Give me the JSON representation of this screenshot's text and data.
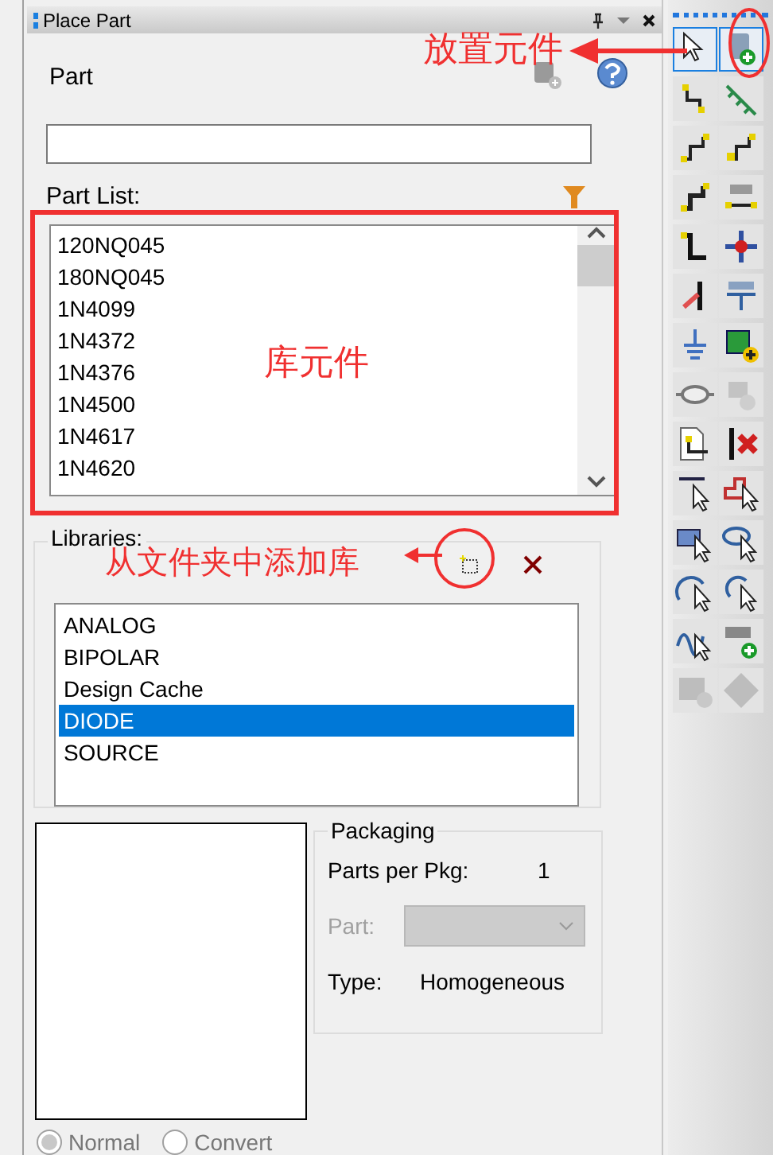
{
  "panel": {
    "title": "Place Part"
  },
  "part": {
    "label": "Part"
  },
  "part_list": {
    "label": "Part List:",
    "items": [
      "120NQ045",
      "180NQ045",
      "1N4099",
      "1N4372",
      "1N4376",
      "1N4500",
      "1N4617",
      "1N4620"
    ]
  },
  "libraries": {
    "label": "Libraries:",
    "items": [
      {
        "name": "ANALOG",
        "selected": false
      },
      {
        "name": "BIPOLAR",
        "selected": false
      },
      {
        "name": "Design Cache",
        "selected": false
      },
      {
        "name": "DIODE",
        "selected": true
      },
      {
        "name": "SOURCE",
        "selected": false
      }
    ]
  },
  "packaging": {
    "title": "Packaging",
    "parts_per_pkg_label": "Parts per Pkg:",
    "parts_per_pkg": "1",
    "part_label": "Part:",
    "part_disabled": true,
    "type_label": "Type:",
    "type": "Homogeneous"
  },
  "view": [
    {
      "label": "Normal",
      "selected": true
    },
    {
      "label": "Convert",
      "selected": false
    }
  ],
  "toolbar": [
    {
      "selected": true,
      "disabled": false
    },
    {
      "selected": true,
      "disabled": false
    },
    {
      "selected": false,
      "disabled": false
    },
    {
      "selected": false,
      "disabled": false
    },
    {
      "selected": false,
      "disabled": false
    },
    {
      "selected": false,
      "disabled": false
    },
    {
      "selected": false,
      "disabled": false
    },
    {
      "selected": false,
      "disabled": false
    },
    {
      "selected": false,
      "disabled": false
    },
    {
      "selected": false,
      "disabled": false
    },
    {
      "selected": false,
      "disabled": false
    },
    {
      "selected": false,
      "disabled": false
    },
    {
      "selected": false,
      "disabled": false
    },
    {
      "selected": false,
      "disabled": false
    },
    {
      "selected": false,
      "disabled": false
    },
    {
      "selected": false,
      "disabled": true
    },
    {
      "selected": false,
      "disabled": false
    },
    {
      "selected": false,
      "disabled": false
    },
    {
      "selected": false,
      "disabled": false
    },
    {
      "selected": false,
      "disabled": false
    },
    {
      "selected": false,
      "disabled": false
    },
    {
      "selected": false,
      "disabled": false
    },
    {
      "selected": false,
      "disabled": false
    },
    {
      "selected": false,
      "disabled": false
    },
    {
      "selected": false,
      "disabled": false
    },
    {
      "selected": false,
      "disabled": false
    },
    {
      "selected": false,
      "disabled": true
    },
    {
      "selected": false,
      "disabled": true
    }
  ],
  "annotations": [
    {
      "text": "放置元件"
    },
    {
      "text": "库元件"
    },
    {
      "text": "从文件夹中添加库"
    }
  ]
}
